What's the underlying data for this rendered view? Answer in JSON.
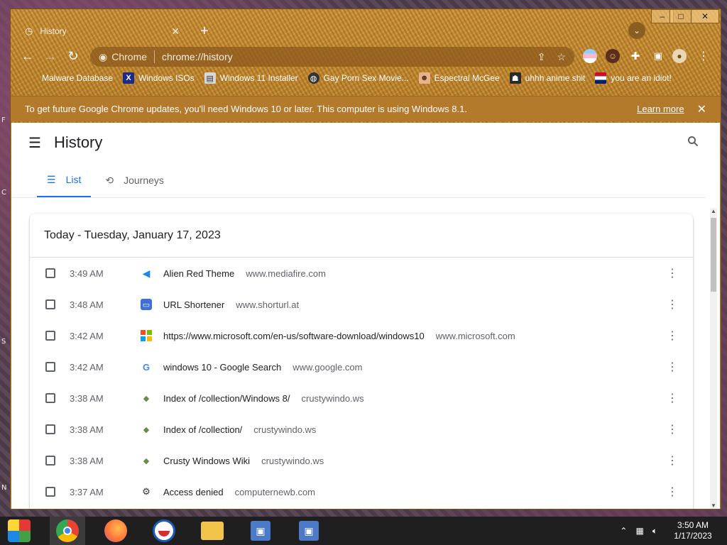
{
  "window": {
    "minimize": "–",
    "maximize": "□",
    "close": "✕"
  },
  "tab": {
    "title": "History"
  },
  "omnibox": {
    "site_label": "Chrome",
    "url": "chrome://history"
  },
  "bookmarks": [
    {
      "label": "Malware Database"
    },
    {
      "label": "Windows ISOs"
    },
    {
      "label": "Windows 11 Installer"
    },
    {
      "label": "Gay Porn Sex Movie..."
    },
    {
      "label": "Espectral McGee"
    },
    {
      "label": "uhhh anime shit"
    },
    {
      "label": "you are an idiot!"
    }
  ],
  "infobar": {
    "message": "To get future Google Chrome updates, you'll need Windows 10 or later. This computer is using Windows 8.1.",
    "learn_more": "Learn more"
  },
  "page": {
    "title": "History",
    "tabs": [
      {
        "label": "List"
      },
      {
        "label": "Journeys"
      }
    ],
    "day_header": "Today - Tuesday, January 17, 2023"
  },
  "history": [
    {
      "time": "3:49 AM",
      "title": "Alien Red Theme",
      "domain": "www.mediafire.com"
    },
    {
      "time": "3:48 AM",
      "title": "URL Shortener",
      "domain": "www.shorturl.at"
    },
    {
      "time": "3:42 AM",
      "title": "https://www.microsoft.com/en-us/software-download/windows10",
      "domain": "www.microsoft.com"
    },
    {
      "time": "3:42 AM",
      "title": "windows 10 - Google Search",
      "domain": "www.google.com"
    },
    {
      "time": "3:38 AM",
      "title": "Index of /collection/Windows 8/",
      "domain": "crustywindo.ws"
    },
    {
      "time": "3:38 AM",
      "title": "Index of /collection/",
      "domain": "crustywindo.ws"
    },
    {
      "time": "3:38 AM",
      "title": "Crusty Windows Wiki",
      "domain": "crustywindo.ws"
    },
    {
      "time": "3:37 AM",
      "title": "Access denied",
      "domain": "computernewb.com"
    }
  ],
  "clock": {
    "time": "3:50 AM",
    "date": "1/17/2023"
  },
  "colors": {
    "accent": "#1a73e8",
    "frame": "#b8812c",
    "taskbar": "#1f1f1f"
  }
}
